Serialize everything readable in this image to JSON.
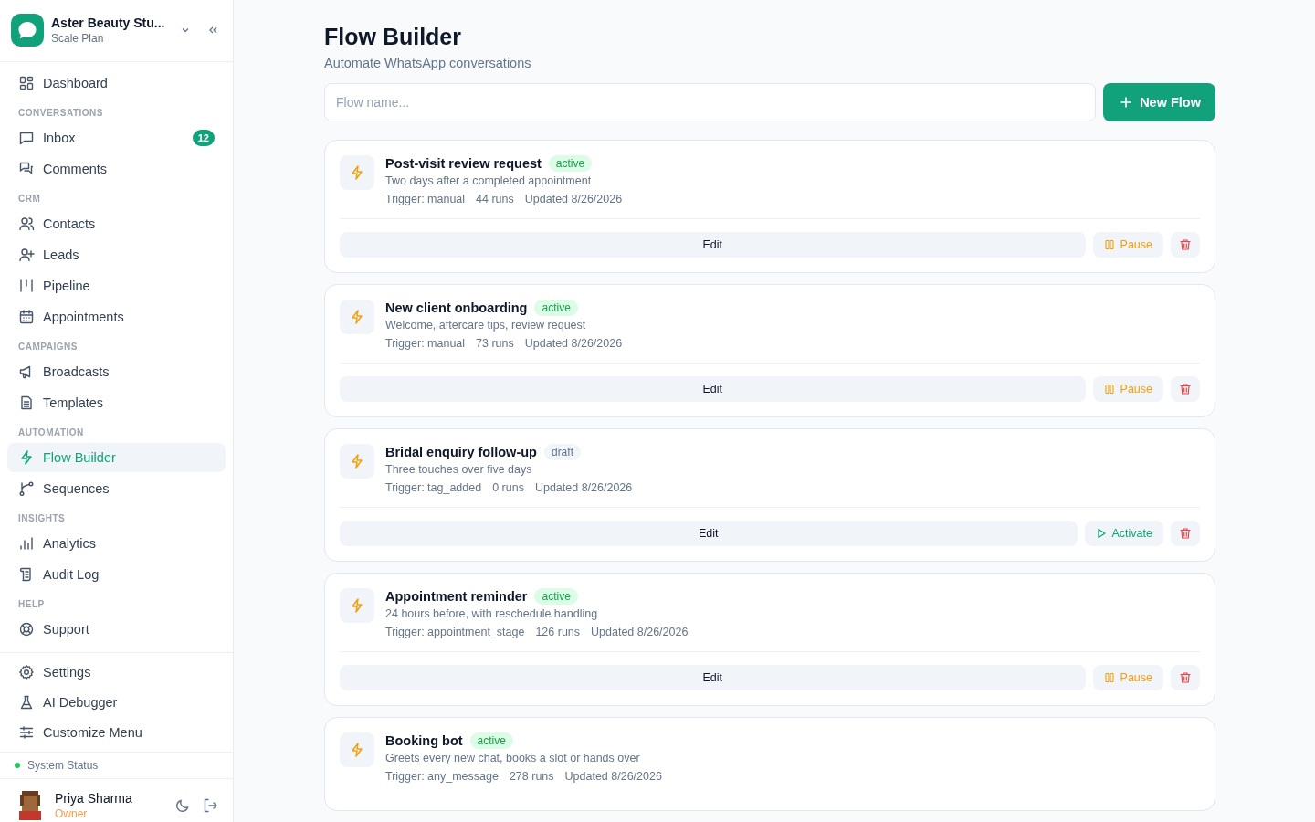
{
  "workspace": {
    "name": "Aster Beauty Stu...",
    "plan": "Scale Plan"
  },
  "nav": [
    {
      "label": "Dashboard",
      "selected": false
    },
    {
      "section": "CONVERSATIONS"
    },
    {
      "label": "Inbox",
      "selected": false,
      "badge": "12"
    },
    {
      "label": "Comments",
      "selected": false
    },
    {
      "section": "CRM"
    },
    {
      "label": "Contacts",
      "selected": false
    },
    {
      "label": "Leads",
      "selected": false
    },
    {
      "label": "Pipeline",
      "selected": false
    },
    {
      "label": "Appointments",
      "selected": false
    },
    {
      "section": "CAMPAIGNS"
    },
    {
      "label": "Broadcasts",
      "selected": false
    },
    {
      "label": "Templates",
      "selected": false
    },
    {
      "section": "AUTOMATION"
    },
    {
      "label": "Flow Builder",
      "selected": true
    },
    {
      "label": "Sequences",
      "selected": false
    },
    {
      "section": "INSIGHTS"
    },
    {
      "label": "Analytics",
      "selected": false
    },
    {
      "label": "Audit Log",
      "selected": false
    },
    {
      "section": "HELP"
    },
    {
      "label": "Support",
      "selected": false
    }
  ],
  "bottom_nav": [
    {
      "label": "Settings",
      "selected": false
    },
    {
      "label": "AI Debugger",
      "selected": false
    },
    {
      "label": "Customize Menu",
      "selected": false
    }
  ],
  "system_status": {
    "label": "System Status",
    "color": "#22c55e"
  },
  "user": {
    "name": "Priya Sharma",
    "role": "Owner"
  },
  "page": {
    "title": "Flow Builder",
    "subtitle": "Automate WhatsApp conversations"
  },
  "search": {
    "placeholder": "Flow name..."
  },
  "new_button": {
    "label": "New Flow"
  },
  "flows": [
    {
      "name": "Post-visit review request",
      "status": {
        "label": "active",
        "kind": "active"
      },
      "description": "Two days after a completed appointment",
      "trigger": "Trigger: manual",
      "runs": "44 runs",
      "updated": "Updated 8/26/2026",
      "actions": {
        "edit": "Edit",
        "toggle": {
          "kind": "pause",
          "label": "Pause"
        }
      }
    },
    {
      "name": "New client onboarding",
      "status": {
        "label": "active",
        "kind": "active"
      },
      "description": "Welcome, aftercare tips, review request",
      "trigger": "Trigger: manual",
      "runs": "73 runs",
      "updated": "Updated 8/26/2026",
      "actions": {
        "edit": "Edit",
        "toggle": {
          "kind": "pause",
          "label": "Pause"
        }
      }
    },
    {
      "name": "Bridal enquiry follow-up",
      "status": {
        "label": "draft",
        "kind": "draft"
      },
      "description": "Three touches over five days",
      "trigger": "Trigger: tag_added",
      "runs": "0 runs",
      "updated": "Updated 8/26/2026",
      "actions": {
        "edit": "Edit",
        "toggle": {
          "kind": "activate",
          "label": "Activate"
        }
      }
    },
    {
      "name": "Appointment reminder",
      "status": {
        "label": "active",
        "kind": "active"
      },
      "description": "24 hours before, with reschedule handling",
      "trigger": "Trigger: appointment_stage",
      "runs": "126 runs",
      "updated": "Updated 8/26/2026",
      "actions": {
        "edit": "Edit",
        "toggle": {
          "kind": "pause",
          "label": "Pause"
        }
      }
    },
    {
      "name": "Booking bot",
      "status": {
        "label": "active",
        "kind": "active"
      },
      "description": "Greets every new chat, books a slot or hands over",
      "trigger": "Trigger: any_message",
      "runs": "278 runs",
      "updated": "Updated 8/26/2026"
    }
  ]
}
